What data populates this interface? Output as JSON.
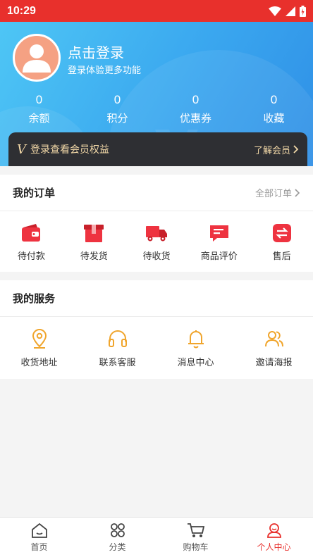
{
  "status_bar": {
    "time": "10:29"
  },
  "header": {
    "login_title": "点击登录",
    "login_subtitle": "登录体验更多功能",
    "stats": [
      {
        "value": "0",
        "label": "余额"
      },
      {
        "value": "0",
        "label": "积分"
      },
      {
        "value": "0",
        "label": "优惠券"
      },
      {
        "value": "0",
        "label": "收藏"
      }
    ],
    "vip": {
      "badge": "V",
      "text": "登录查看会员权益",
      "link": "了解会员"
    }
  },
  "orders": {
    "title": "我的订单",
    "all_link": "全部订单",
    "items": [
      {
        "label": "待付款",
        "icon": "wallet-icon"
      },
      {
        "label": "待发货",
        "icon": "package-icon"
      },
      {
        "label": "待收货",
        "icon": "truck-icon"
      },
      {
        "label": "商品评价",
        "icon": "comment-icon"
      },
      {
        "label": "售后",
        "icon": "exchange-icon"
      }
    ]
  },
  "services": {
    "title": "我的服务",
    "items": [
      {
        "label": "收货地址",
        "icon": "location-icon"
      },
      {
        "label": "联系客服",
        "icon": "headset-icon"
      },
      {
        "label": "消息中心",
        "icon": "bell-icon"
      },
      {
        "label": "邀请海报",
        "icon": "users-icon"
      }
    ]
  },
  "tabbar": {
    "items": [
      {
        "label": "首页",
        "icon": "home-icon"
      },
      {
        "label": "分类",
        "icon": "grid-icon"
      },
      {
        "label": "购物车",
        "icon": "cart-icon"
      },
      {
        "label": "个人中心",
        "icon": "profile-icon"
      }
    ],
    "active": "个人中心"
  },
  "colors": {
    "accent": "#e8302c",
    "service_icon": "#f0a52c",
    "header_blue": "#3aa7ef",
    "vip_bg": "#2e2f33",
    "vip_text": "#f3d9a8"
  }
}
